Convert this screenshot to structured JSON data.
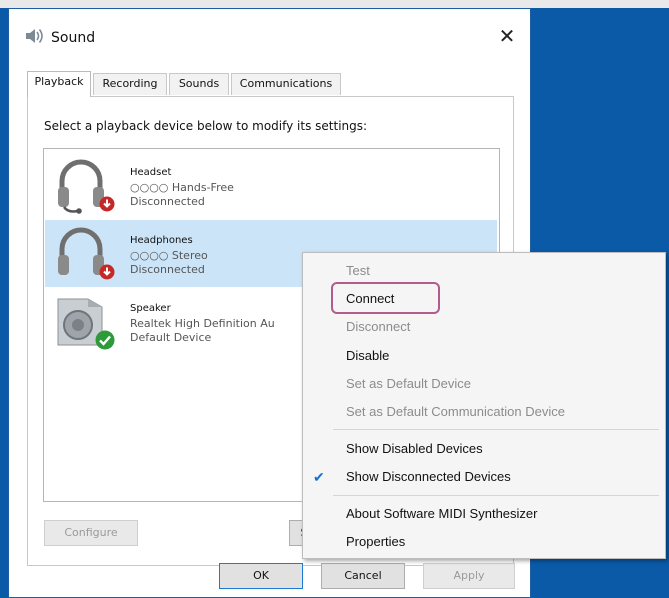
{
  "window": {
    "title": "Sound",
    "close_glyph": "✕"
  },
  "tabs": [
    {
      "label": "Playback",
      "active": true
    },
    {
      "label": "Recording"
    },
    {
      "label": "Sounds"
    },
    {
      "label": "Communications"
    }
  ],
  "instruction": "Select a playback device below to modify its settings:",
  "devices": [
    {
      "name": "Headset",
      "desc": "○○○○ Hands-Free",
      "status": "Disconnected",
      "icon": "headset-icon",
      "badge": "disconnected-badge-icon"
    },
    {
      "name": "Headphones",
      "desc": "○○○○ Stereo",
      "status": "Disconnected",
      "icon": "headphones-icon",
      "badge": "disconnected-badge-icon",
      "selected": true
    },
    {
      "name": "Speaker",
      "desc": "Realtek High Definition Au",
      "status": "Default Device",
      "icon": "speaker-icon",
      "badge": "default-check-badge-icon"
    }
  ],
  "buttons": {
    "configure": "Configure",
    "set_default_partial": "S",
    "ok": "OK",
    "cancel": "Cancel",
    "apply": "Apply"
  },
  "context_menu": {
    "items": [
      {
        "label": "Test",
        "enabled": false
      },
      {
        "label": "Connect",
        "enabled": true,
        "highlighted": true
      },
      {
        "label": "Disconnect",
        "enabled": false
      },
      {
        "label": "Disable",
        "enabled": true
      },
      {
        "label": "Set as Default Device",
        "enabled": false
      },
      {
        "label": "Set as Default Communication Device",
        "enabled": false
      },
      {
        "label": "Show Disabled Devices",
        "enabled": true
      },
      {
        "label": "Show Disconnected Devices",
        "enabled": true,
        "checked": true
      },
      {
        "label": "About Software MIDI Synthesizer",
        "enabled": true
      },
      {
        "label": "Properties",
        "enabled": true
      }
    ],
    "highlight_color": "#b05c8c"
  },
  "colors": {
    "desktop": "#0a5aa8",
    "selection": "#cce4f7",
    "check": "#1c6fd1"
  }
}
